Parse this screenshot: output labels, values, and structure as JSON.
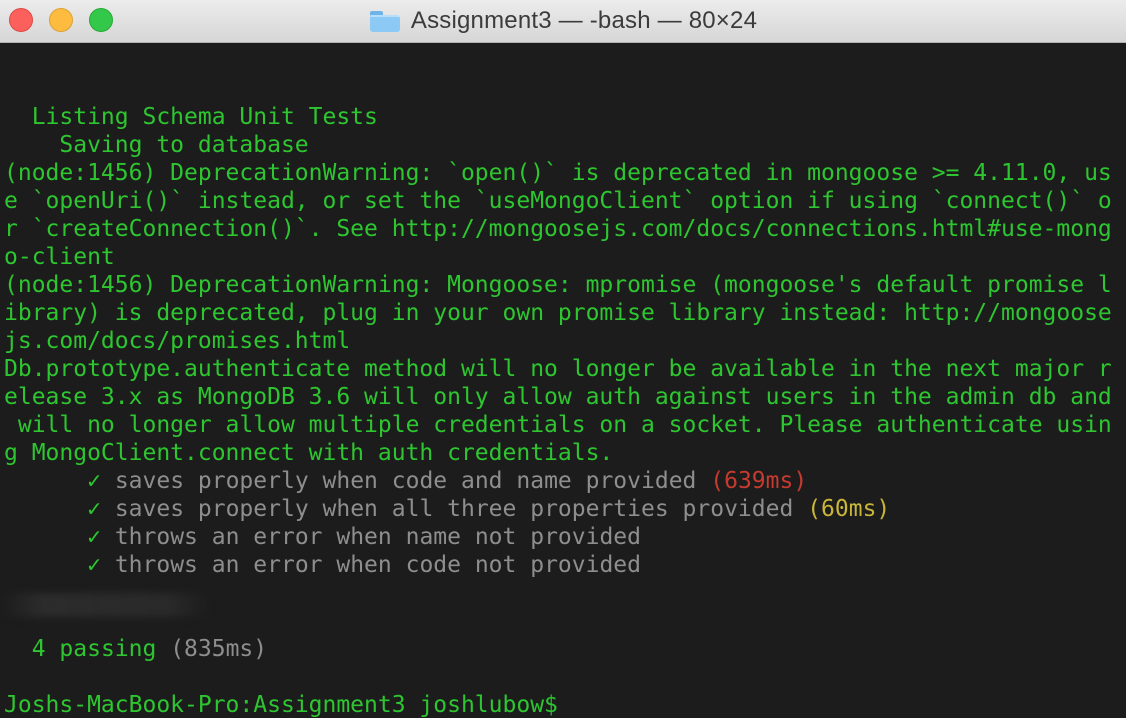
{
  "window": {
    "title": "Assignment3 — -bash — 80×24",
    "buttons": [
      "close",
      "minimize",
      "maximize"
    ]
  },
  "terminal": {
    "lines": [
      "  Listing Schema Unit Tests",
      "    Saving to database",
      "(node:1456) DeprecationWarning: `open()` is deprecated in mongoose >= 4.11.0, us",
      "e `openUri()` instead, or set the `useMongoClient` option if using `connect()` o",
      "r `createConnection()`. See http://mongoosejs.com/docs/connections.html#use-mong",
      "o-client",
      "(node:1456) DeprecationWarning: Mongoose: mpromise (mongoose's default promise l",
      "ibrary) is deprecated, plug in your own promise library instead: http://mongoose",
      "js.com/docs/promises.html",
      "Db.prototype.authenticate method will no longer be available in the next major r",
      "elease 3.x as MongoDB 3.6 will only allow auth against users in the admin db and",
      " will no longer allow multiple credentials on a socket. Please authenticate usin",
      "g MongoClient.connect with auth credentials."
    ],
    "tests": [
      {
        "check": "✓",
        "text": "saves properly when code and name provided",
        "duration": "(639ms)",
        "duration_color": "#c73a2f"
      },
      {
        "check": "✓",
        "text": "saves properly when all three properties provided",
        "duration": "(60ms)",
        "duration_color": "#c9b53a"
      },
      {
        "check": "✓",
        "text": "throws an error when name not provided",
        "duration": "",
        "duration_color": ""
      },
      {
        "check": "✓",
        "text": "throws an error when code not provided",
        "duration": "",
        "duration_color": ""
      }
    ],
    "summary": {
      "passing": "4 passing",
      "time": "(835ms)"
    },
    "prompt": "Joshs-MacBook-Pro:Assignment3 joshlubow$"
  },
  "colors": {
    "text_green": "#2ec630",
    "text_gray": "#8e8e8e",
    "slow_red": "#c73a2f",
    "medium_yellow": "#c9b53a",
    "background": "#1c1c1c"
  }
}
